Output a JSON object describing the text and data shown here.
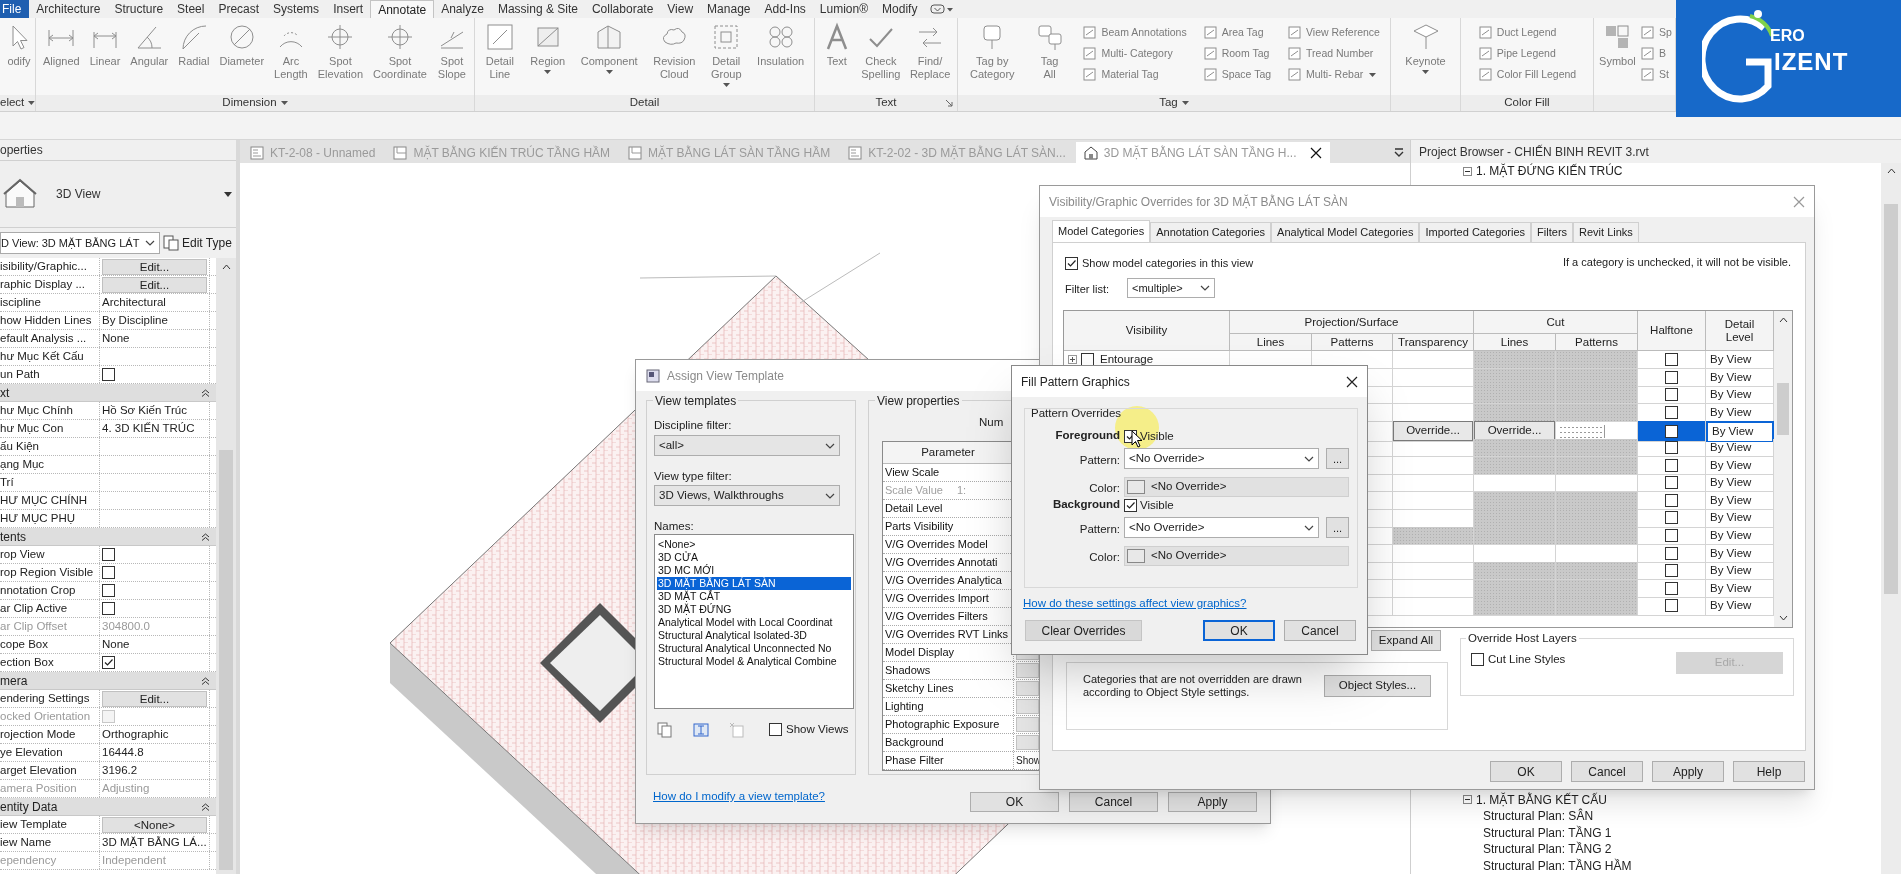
{
  "ribbon": {
    "tabs": [
      {
        "label": "File",
        "kind": "file",
        "selected": false
      },
      {
        "label": "Architecture",
        "kind": "tab",
        "selected": false
      },
      {
        "label": "Structure",
        "kind": "tab",
        "selected": false
      },
      {
        "label": "Steel",
        "kind": "tab",
        "selected": false
      },
      {
        "label": "Precast",
        "kind": "tab",
        "selected": false
      },
      {
        "label": "Systems",
        "kind": "tab",
        "selected": false
      },
      {
        "label": "Insert",
        "kind": "tab",
        "selected": false
      },
      {
        "label": "Annotate",
        "kind": "tab",
        "selected": true
      },
      {
        "label": "Analyze",
        "kind": "tab",
        "selected": false
      },
      {
        "label": "Massing & Site",
        "kind": "tab",
        "selected": false
      },
      {
        "label": "Collaborate",
        "kind": "tab",
        "selected": false
      },
      {
        "label": "View",
        "kind": "tab",
        "selected": false
      },
      {
        "label": "Manage",
        "kind": "tab",
        "selected": false
      },
      {
        "label": "Add-Ins",
        "kind": "tab",
        "selected": false
      },
      {
        "label": "Lumion®",
        "kind": "tab",
        "selected": false
      },
      {
        "label": "Modify",
        "kind": "tab",
        "selected": false
      }
    ],
    "panels": [
      {
        "label": "elect",
        "has_menu": true,
        "launcher": false,
        "tools": [
          {
            "label": "odify",
            "kind": "large",
            "has_menu": false
          }
        ]
      },
      {
        "label": "Dimension",
        "has_menu": true,
        "launcher": false,
        "tools": [
          {
            "label": "Aligned",
            "kind": "large",
            "has_menu": false
          },
          {
            "label": "Linear",
            "kind": "large",
            "has_menu": false
          },
          {
            "label": "Angular",
            "kind": "large",
            "has_menu": false
          },
          {
            "label": "Radial",
            "kind": "large",
            "has_menu": false
          },
          {
            "label": "Diameter",
            "kind": "large",
            "has_menu": false
          },
          {
            "label": "Arc\nLength",
            "kind": "large",
            "has_menu": false
          },
          {
            "label": "Spot\nElevation",
            "kind": "large",
            "has_menu": false
          },
          {
            "label": "Spot\nCoordinate",
            "kind": "large",
            "has_menu": false
          },
          {
            "label": "Spot\nSlope",
            "kind": "large",
            "has_menu": false
          }
        ]
      },
      {
        "label": "Detail",
        "has_menu": false,
        "launcher": false,
        "tools": [
          {
            "label": "Detail\nLine",
            "kind": "large",
            "has_menu": false
          },
          {
            "label": "Region",
            "kind": "large",
            "has_menu": true
          },
          {
            "label": "Component",
            "kind": "large",
            "has_menu": true
          },
          {
            "label": "Revision\nCloud",
            "kind": "large",
            "has_menu": false
          },
          {
            "label": "Detail\nGroup",
            "kind": "large",
            "has_menu": true
          },
          {
            "label": "Insulation",
            "kind": "large",
            "has_menu": false
          }
        ]
      },
      {
        "label": "Text",
        "has_menu": false,
        "launcher": true,
        "tools": [
          {
            "label": "Text",
            "kind": "large",
            "has_menu": false
          },
          {
            "label": "Check\nSpelling",
            "kind": "large",
            "has_menu": false
          },
          {
            "label": "Find/\nReplace",
            "kind": "large",
            "has_menu": false
          }
        ]
      },
      {
        "label": "Tag",
        "has_menu": true,
        "launcher": false,
        "tools": [
          {
            "label": "Tag by\nCategory",
            "kind": "large",
            "has_menu": false
          },
          {
            "label": "Tag\nAll",
            "kind": "large",
            "has_menu": false
          },
          {
            "label": "Beam Annotations",
            "kind": "small",
            "has_menu": false
          },
          {
            "label": "Multi- Category",
            "kind": "small",
            "has_menu": false
          },
          {
            "label": "Material Tag",
            "kind": "small",
            "has_menu": false
          },
          {
            "label": "Area Tag",
            "kind": "small",
            "has_menu": false
          },
          {
            "label": "Room Tag",
            "kind": "small",
            "has_menu": false
          },
          {
            "label": "Space Tag",
            "kind": "small",
            "has_menu": false
          },
          {
            "label": "View Reference",
            "kind": "small",
            "has_menu": false
          },
          {
            "label": "Tread Number",
            "kind": "small",
            "has_menu": false
          },
          {
            "label": "Multi- Rebar",
            "kind": "small",
            "has_menu": true
          }
        ]
      },
      {
        "has_menu": false,
        "launcher": false,
        "tools": [
          {
            "label": "Keynote",
            "kind": "large",
            "has_menu": true
          }
        ]
      },
      {
        "label": "Color Fill",
        "has_menu": false,
        "launcher": false,
        "tools": [
          {
            "label": "Duct Legend",
            "kind": "small",
            "has_menu": false
          },
          {
            "label": "Pipe Legend",
            "kind": "small",
            "has_menu": false
          },
          {
            "label": "Color Fill Legend",
            "kind": "small",
            "has_menu": false
          }
        ]
      },
      {
        "has_menu": false,
        "launcher": false,
        "tools": [
          {
            "label": "Symbol",
            "kind": "large",
            "has_menu": false
          },
          {
            "label": "Sp",
            "kind": "small",
            "has_menu": false
          },
          {
            "label": "B",
            "kind": "small",
            "has_menu": false
          },
          {
            "label": "St",
            "kind": "small",
            "has_menu": false
          }
        ]
      }
    ]
  },
  "logo": {
    "line_1": "ERO",
    "line_2": "IZENT"
  },
  "properties": {
    "title": "operties",
    "type_name": "3D View",
    "selector": "D View: 3D MẶT BẰNG LÁT",
    "edit_type": "Edit Type",
    "rows": [
      {
        "kind": "button",
        "label": "isibility/Graphic...",
        "value": "Edit...",
        "disabled": false
      },
      {
        "kind": "button",
        "label": "raphic Display ...",
        "value": "Edit...",
        "disabled": false
      },
      {
        "kind": "text",
        "label": "iscipline",
        "value": "Architectural",
        "disabled": false
      },
      {
        "kind": "text",
        "label": "how Hidden Lines",
        "value": "By Discipline",
        "disabled": false
      },
      {
        "kind": "text",
        "label": "efault Analysis ...",
        "value": "None",
        "disabled": false
      },
      {
        "kind": "text",
        "label": "hư Mục Kết Cấu",
        "disabled": false
      },
      {
        "kind": "checkbox",
        "label": "un Path",
        "checked": false,
        "disabled": false
      },
      {
        "kind": "section",
        "label": "xt"
      },
      {
        "kind": "text",
        "label": "hư Mục Chính",
        "value": "Hồ Sơ Kiến Trúc",
        "disabled": false
      },
      {
        "kind": "text",
        "label": "hư Mục Con",
        "value": "4. 3D KIẾN TRÚC",
        "disabled": false
      },
      {
        "kind": "text",
        "label": "ấu Kiện",
        "disabled": false
      },
      {
        "kind": "text",
        "label": "ạng Mục",
        "disabled": false
      },
      {
        "kind": "text",
        "label": "Trí",
        "disabled": false
      },
      {
        "kind": "text",
        "label": "HƯ MỤC CHÍNH",
        "disabled": false
      },
      {
        "kind": "text",
        "label": "HƯ MỤC PHỤ",
        "disabled": false
      },
      {
        "kind": "section",
        "label": "tents"
      },
      {
        "kind": "checkbox",
        "label": "rop View",
        "checked": false,
        "disabled": false
      },
      {
        "kind": "checkbox",
        "label": "rop Region Visible",
        "checked": false,
        "disabled": false
      },
      {
        "kind": "checkbox",
        "label": "nnotation Crop",
        "checked": false,
        "disabled": false
      },
      {
        "kind": "checkbox",
        "label": "ar Clip Active",
        "checked": false,
        "disabled": false
      },
      {
        "kind": "text",
        "label": "ar Clip Offset",
        "value": "304800.0",
        "disabled": true
      },
      {
        "kind": "text",
        "label": "cope Box",
        "value": "None",
        "disabled": false
      },
      {
        "kind": "checkbox",
        "label": "ection Box",
        "checked": true,
        "disabled": false
      },
      {
        "kind": "section",
        "label": "mera"
      },
      {
        "kind": "button",
        "label": "endering Settings",
        "value": "Edit...",
        "disabled": false
      },
      {
        "kind": "checkbox",
        "label": "ocked Orientation",
        "checked": false,
        "disabled": true
      },
      {
        "kind": "text",
        "label": "rojection Mode",
        "value": "Orthographic",
        "disabled": false
      },
      {
        "kind": "text",
        "label": "ye Elevation",
        "value": "16444.8",
        "disabled": false
      },
      {
        "kind": "text",
        "label": "arget Elevation",
        "value": "3196.2",
        "disabled": false
      },
      {
        "kind": "text",
        "label": "amera Position",
        "value": "Adjusting",
        "disabled": true
      },
      {
        "kind": "section",
        "label": "entity Data"
      },
      {
        "kind": "button",
        "label": "iew Template",
        "value": "<None>",
        "disabled": false
      },
      {
        "kind": "text",
        "label": "iew Name",
        "value": "3D MẶT BẰNG LÁ...",
        "disabled": false
      },
      {
        "kind": "text",
        "label": "ependency",
        "value": "Independent",
        "disabled": true
      }
    ]
  },
  "view_tabs": [
    {
      "label": "KT-2-08 - Unnamed",
      "kind": "sheet",
      "selected": false
    },
    {
      "label": "MẶT BẰNG KIẾN TRÚC TẦNG HẦM",
      "kind": "plan",
      "selected": false
    },
    {
      "label": "MẶT BẰNG LÁT SÀN TẦNG HẦM",
      "kind": "plan",
      "selected": false
    },
    {
      "label": "KT-2-02 - 3D MẶT BẰNG LÁT SÀN...",
      "kind": "sheet",
      "selected": false
    },
    {
      "label": "3D MẶT BẰNG LÁT SÀN TẦNG H...",
      "kind": "model",
      "selected": true
    }
  ],
  "project_browser": {
    "title": "Project Browser - CHIẾN BINH REVIT 3.rvt",
    "tree": [
      {
        "label": "1. MẶT ĐỨNG KIẾN TRÚC",
        "expanded": true
      },
      {
        "label": "1. MẶT BẰNG KẾT CẤU",
        "expanded": true,
        "children": [
          {
            "label": "Structural Plan: SÂN"
          },
          {
            "label": "Structural Plan: TẦNG 1"
          },
          {
            "label": "Structural Plan: TẦNG 2"
          },
          {
            "label": "Structural Plan: TẦNG HẦM"
          }
        ]
      }
    ]
  },
  "assign_dialog": {
    "title": "Assign View Template",
    "templates_group": "View templates",
    "discipline_label": "Discipline filter:",
    "discipline_value": "<all>",
    "type_label": "View type filter:",
    "type_value": "3D Views, Walkthroughs",
    "names_label": "Names:",
    "names": [
      {
        "label": "<None>",
        "selected": false
      },
      {
        "label": "3D CỬA",
        "selected": false
      },
      {
        "label": "3D MC MỚI",
        "selected": false
      },
      {
        "label": "3D MẶT BẰNG LÁT SÀN",
        "selected": true
      },
      {
        "label": "3D MẶT CẮT",
        "selected": false
      },
      {
        "label": "3D MẶT ĐỨNG",
        "selected": false
      },
      {
        "label": "Analytical Model with Local Coordinat",
        "selected": false
      },
      {
        "label": "Structural Analytical Isolated-3D",
        "selected": false
      },
      {
        "label": "Structural Analytical Unconnected No",
        "selected": false
      },
      {
        "label": "Structural Model & Analytical Combine",
        "selected": false
      }
    ],
    "show_views": {
      "label": "Show Views",
      "checked": false
    },
    "properties_group": "View properties",
    "count_label": "Num",
    "param_header": "Parameter",
    "params": [
      {
        "name": "View Scale",
        "kind": "text",
        "disabled": false
      },
      {
        "name": "Scale Value",
        "suffix": "1:",
        "kind": "text",
        "disabled": true
      },
      {
        "name": "Detail Level",
        "kind": "text",
        "disabled": false
      },
      {
        "name": "Parts Visibility",
        "kind": "text",
        "disabled": false
      },
      {
        "name": "V/G Overrides Model",
        "kind": "text",
        "disabled": false
      },
      {
        "name": "V/G Overrides Annotati",
        "kind": "text",
        "disabled": false
      },
      {
        "name": "V/G Overrides Analytica",
        "kind": "text",
        "disabled": false
      },
      {
        "name": "V/G Overrides Import",
        "kind": "text",
        "disabled": false
      },
      {
        "name": "V/G Overrides Filters",
        "kind": "text",
        "disabled": false
      },
      {
        "name": "V/G Overrides RVT Links",
        "kind": "text",
        "disabled": false
      },
      {
        "name": "Model Display",
        "kind": "button",
        "disabled": false
      },
      {
        "name": "Shadows",
        "kind": "button",
        "disabled": false
      },
      {
        "name": "Sketchy Lines",
        "kind": "button",
        "disabled": false
      },
      {
        "name": "Lighting",
        "kind": "button",
        "disabled": false
      },
      {
        "name": "Photographic Exposure",
        "kind": "button",
        "disabled": false
      },
      {
        "name": "Background",
        "kind": "button",
        "disabled": false
      },
      {
        "name": "Phase Filter",
        "kind": "text",
        "value": "Show",
        "disabled": false
      }
    ],
    "link": "How do I modify a view template?",
    "buttons": [
      "OK",
      "Cancel",
      "Apply"
    ]
  },
  "vg_dialog": {
    "title": "Visibility/Graphic Overrides for 3D MẶT BẰNG LÁT SÀN",
    "tabs": [
      {
        "label": "Model Categories",
        "selected": true
      },
      {
        "label": "Annotation Categories",
        "selected": false
      },
      {
        "label": "Analytical Model Categories",
        "selected": false
      },
      {
        "label": "Imported Categories",
        "selected": false
      },
      {
        "label": "Filters",
        "selected": false
      },
      {
        "label": "Revit Links",
        "selected": false
      }
    ],
    "show_categories": {
      "label": "Show model categories in this view",
      "checked": true
    },
    "hint": "If a category is unchecked, it will not be visible.",
    "filter_label": "Filter list:",
    "filter_value": "<multiple>",
    "columns": {
      "visibility": "Visibility",
      "projection": "Projection/Surface",
      "proj_lines": "Lines",
      "proj_patterns": "Patterns",
      "transparency": "Transparency",
      "cut": "Cut",
      "cut_lines": "Lines",
      "cut_patterns": "Patterns",
      "halftone": "Halftone",
      "detail_level": "Detail\nLevel"
    },
    "rows": [
      {
        "name": "Entourage",
        "visible": false,
        "selected": false,
        "surface_shaded": false,
        "cut_shaded": true,
        "halftone": false,
        "detail_level": "By View"
      },
      {
        "selected": false,
        "surface_shaded": false,
        "cut_shaded": true,
        "halftone": false,
        "detail_level": "By View"
      },
      {
        "selected": false,
        "surface_shaded": false,
        "cut_shaded": true,
        "halftone": false,
        "detail_level": "By View"
      },
      {
        "selected": false,
        "surface_shaded": false,
        "cut_shaded": true,
        "halftone": false,
        "detail_level": "By View"
      },
      {
        "selected": true,
        "surface_shaded": false,
        "cut_shaded": false,
        "transparency": "Override...",
        "cut_lines": "Override...",
        "halftone": false,
        "detail_level": "By View"
      },
      {
        "selected": false,
        "surface_shaded": false,
        "cut_shaded": true,
        "halftone": false,
        "detail_level": "By View"
      },
      {
        "selected": false,
        "surface_shaded": false,
        "cut_shaded": true,
        "halftone": false,
        "detail_level": "By View"
      },
      {
        "selected": false,
        "surface_shaded": false,
        "cut_shaded": false,
        "halftone": false,
        "detail_level": "By View"
      },
      {
        "selected": false,
        "surface_shaded": false,
        "cut_shaded": true,
        "halftone": false,
        "detail_level": "By View"
      },
      {
        "selected": false,
        "surface_shaded": false,
        "cut_shaded": true,
        "halftone": false,
        "detail_level": "By View"
      },
      {
        "selected": false,
        "surface_shaded": true,
        "cut_shaded": true,
        "halftone": false,
        "detail_level": "By View"
      },
      {
        "selected": false,
        "surface_shaded": false,
        "cut_shaded": false,
        "halftone": false,
        "detail_level": "By View"
      },
      {
        "selected": false,
        "surface_shaded": false,
        "cut_shaded": true,
        "halftone": false,
        "detail_level": "By View"
      },
      {
        "selected": false,
        "surface_shaded": false,
        "cut_shaded": true,
        "halftone": false,
        "detail_level": "By View"
      },
      {
        "selected": false,
        "surface_shaded": false,
        "cut_shaded": true,
        "halftone": false,
        "detail_level": "By View"
      }
    ],
    "expand_all": "Expand All",
    "note": "Categories that are not overridden are drawn according to Object Style settings.",
    "object_styles": "Object Styles...",
    "host_layers": {
      "title": "Override Host Layers",
      "cut_line_styles": {
        "label": "Cut Line Styles",
        "checked": false
      },
      "edit": "Edit..."
    },
    "buttons": [
      "OK",
      "Cancel",
      "Apply",
      "Help"
    ]
  },
  "fill_dialog": {
    "title": "Fill Pattern Graphics",
    "group": "Pattern Overrides",
    "layers": [
      {
        "label": "Foreground",
        "visible_label": "Visible",
        "visible": true,
        "pattern_label": "Pattern:",
        "pattern": "<No Override>",
        "browse": "...",
        "color_label": "Color:",
        "color_value": "<No Override>"
      },
      {
        "label": "Background",
        "visible_label": "Visible",
        "visible": true,
        "pattern_label": "Pattern:",
        "pattern": "<No Override>",
        "browse": "...",
        "color_label": "Color:",
        "color_value": "<No Override>"
      }
    ],
    "link": "How do these settings affect view graphics?",
    "buttons": [
      {
        "label": "Clear Overrides",
        "default": false
      },
      {
        "label": "OK",
        "default": true
      },
      {
        "label": "Cancel",
        "default": false
      }
    ]
  }
}
